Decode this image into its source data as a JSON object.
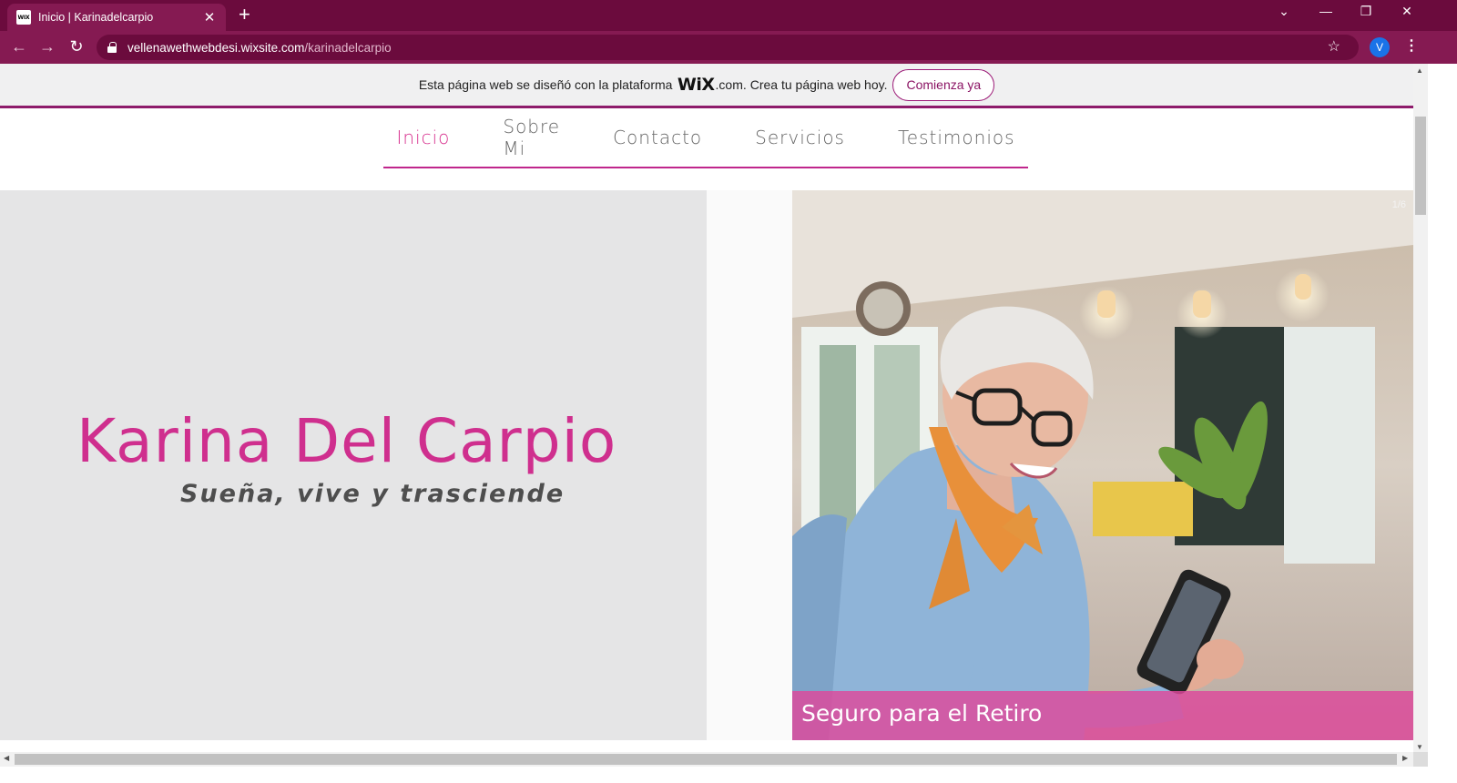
{
  "browser": {
    "tab_title": "Inicio | Karinadelcarpio",
    "favicon_text": "WIX",
    "url_host": "vellenawethwebdesi.wixsite.com",
    "url_path": "/karinadelcarpio",
    "profile_initial": "V",
    "theme_color": "#6b0b3d"
  },
  "wix_banner": {
    "text_before": "Esta página web se diseñó con la plataforma",
    "logo": "WiX",
    "logo_suffix": ".com.",
    "text_after": "Crea tu página web hoy.",
    "button_label": "Comienza ya"
  },
  "nav": {
    "items": [
      {
        "label": "Inicio",
        "active": true
      },
      {
        "label": "Sobre Mi",
        "active": false
      },
      {
        "label": "Contacto",
        "active": false
      },
      {
        "label": "Servicios",
        "active": false
      },
      {
        "label": "Testimonios",
        "active": false
      }
    ]
  },
  "hero": {
    "name": "Karina Del Carpio",
    "tagline": "Sueña, vive y trasciende",
    "accent_color": "#cf2f8e"
  },
  "slideshow": {
    "counter": "1/6",
    "caption": "Seguro para el Retiro"
  }
}
